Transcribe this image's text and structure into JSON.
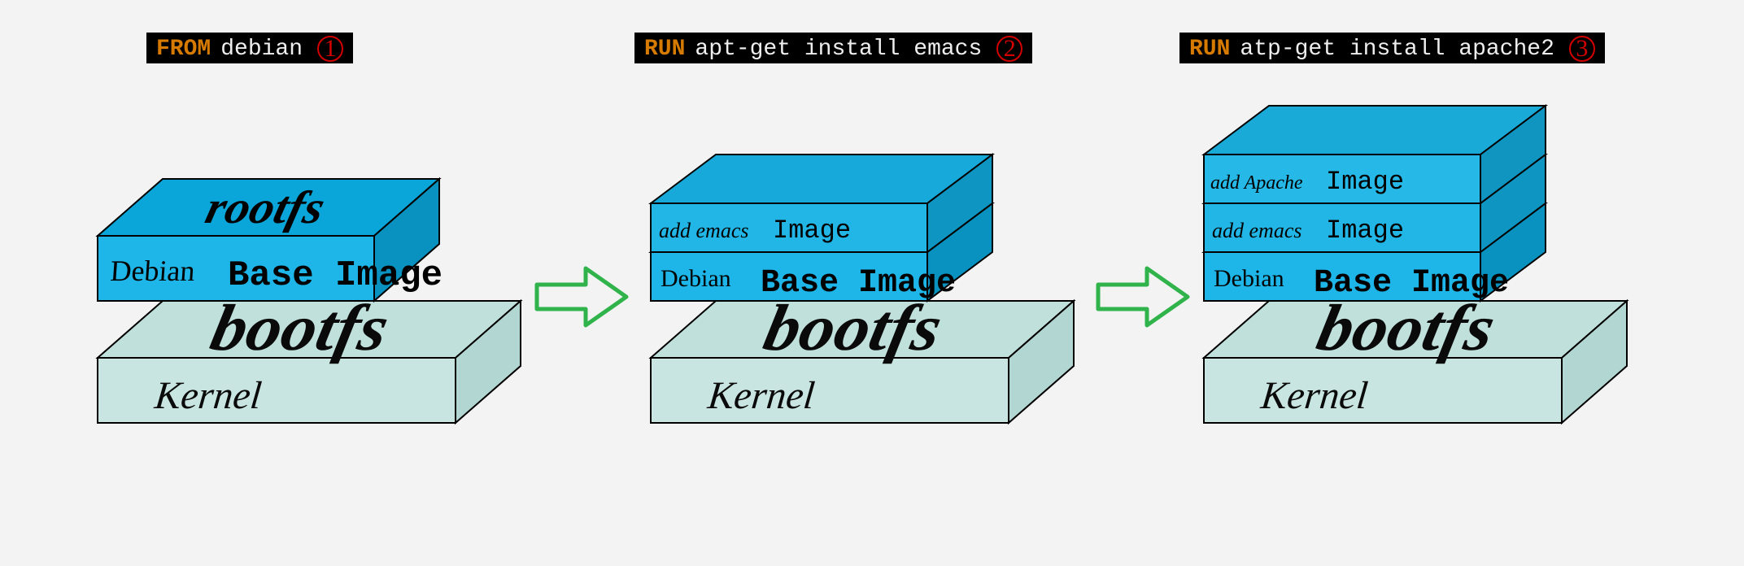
{
  "commands": [
    {
      "keyword": "FROM",
      "args": "debian",
      "num": "1"
    },
    {
      "keyword": "RUN",
      "args": "apt-get install emacs",
      "num": "2"
    },
    {
      "keyword": "RUN",
      "args": "atp-get install apache2",
      "num": "3"
    }
  ],
  "base": {
    "bootfs": "bootfs",
    "kernel": "Kernel"
  },
  "debian_layer": {
    "side": "Debian",
    "top": "rootfs",
    "front": "Base Image"
  },
  "emacs_layer": {
    "side": "add emacs",
    "front": "Image"
  },
  "apache_layer": {
    "side": "add Apache",
    "front": "Image"
  }
}
